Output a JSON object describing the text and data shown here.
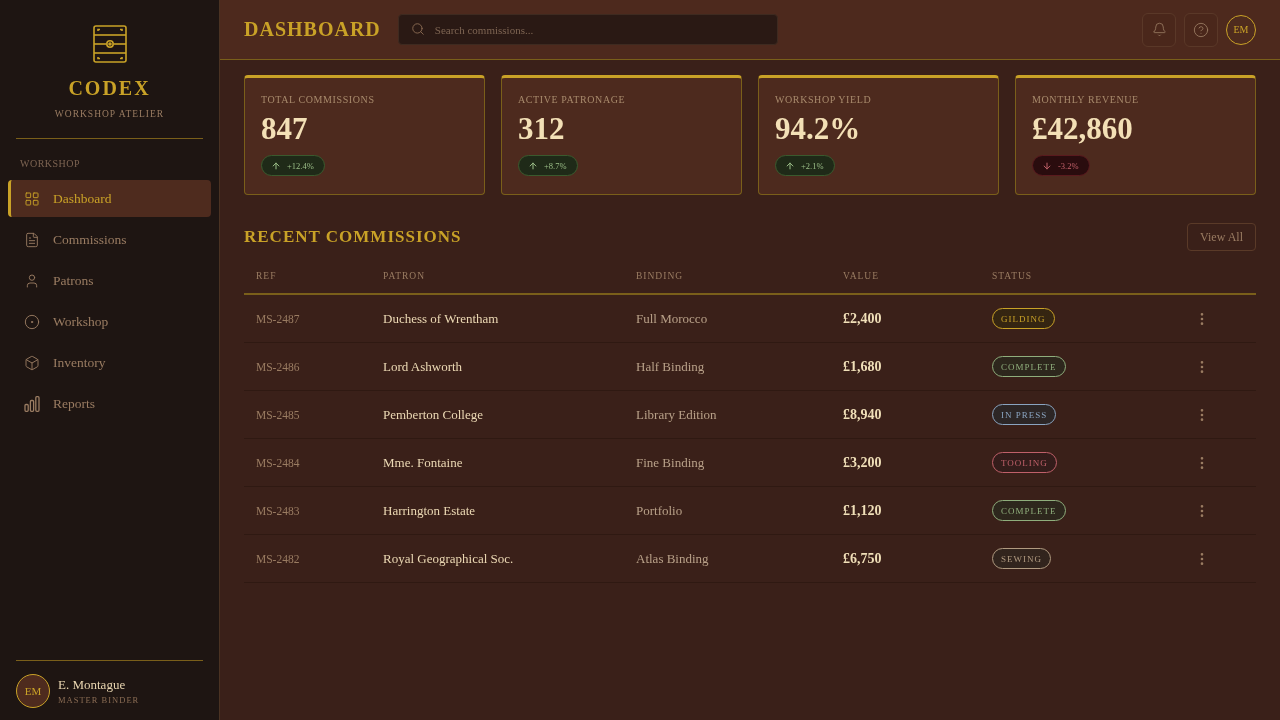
{
  "sidebar": {
    "brand": {
      "name": "CODEX",
      "tagline": "WORKSHOP ATELIER"
    },
    "section_label": "WORKSHOP",
    "items": [
      {
        "label": "Dashboard",
        "selected": true
      },
      {
        "label": "Commissions",
        "selected": false
      },
      {
        "label": "Patrons",
        "selected": false
      },
      {
        "label": "Workshop",
        "selected": false
      },
      {
        "label": "Inventory",
        "selected": false
      },
      {
        "label": "Reports",
        "selected": false
      }
    ],
    "user": {
      "initials": "EM",
      "name": "E. Montague",
      "role": "MASTER BINDER"
    }
  },
  "header": {
    "title": "DASHBOARD",
    "search": {
      "placeholder": "Search commissions..."
    },
    "avatar_initials": "EM"
  },
  "stats": [
    {
      "label": "TOTAL COMMISSIONS",
      "value": "847",
      "change": "+12.4%",
      "rising": true
    },
    {
      "label": "ACTIVE PATRONAGE",
      "value": "312",
      "change": "+8.7%",
      "rising": true
    },
    {
      "label": "WORKSHOP YIELD",
      "value": "94.2%",
      "change": "+2.1%",
      "rising": true
    },
    {
      "label": "MONTHLY REVENUE",
      "value": "£42,860",
      "change": "-3.2%",
      "rising": false
    }
  ],
  "recent_commissions": {
    "title": "RECENT COMMISSIONS",
    "view_all": "View All",
    "columns": [
      "REF",
      "PATRON",
      "BINDING",
      "VALUE",
      "STATUS"
    ],
    "rows": [
      {
        "ref": "MS-2487",
        "patron": "Duchess of Wrentham",
        "binding": "Full Morocco",
        "value": "£2,400",
        "status": {
          "label": "GILDING",
          "color": "#c9a227"
        }
      },
      {
        "ref": "MS-2486",
        "patron": "Lord Ashworth",
        "binding": "Half Binding",
        "value": "£1,680",
        "status": {
          "label": "COMPLETE",
          "color": "#8fae7c"
        }
      },
      {
        "ref": "MS-2485",
        "patron": "Pemberton College",
        "binding": "Library Edition",
        "value": "£8,940",
        "status": {
          "label": "IN PRESS",
          "color": "#8aa4c0"
        }
      },
      {
        "ref": "MS-2484",
        "patron": "Mme. Fontaine",
        "binding": "Fine Binding",
        "value": "£3,200",
        "status": {
          "label": "TOOLING",
          "color": "#c0606a"
        }
      },
      {
        "ref": "MS-2483",
        "patron": "Harrington Estate",
        "binding": "Portfolio",
        "value": "£1,120",
        "status": {
          "label": "COMPLETE",
          "color": "#8fae7c"
        }
      },
      {
        "ref": "MS-2482",
        "patron": "Royal Geographical Soc.",
        "binding": "Atlas Binding",
        "value": "£6,750",
        "status": {
          "label": "SEWING",
          "color": "#b09a80"
        }
      }
    ]
  }
}
